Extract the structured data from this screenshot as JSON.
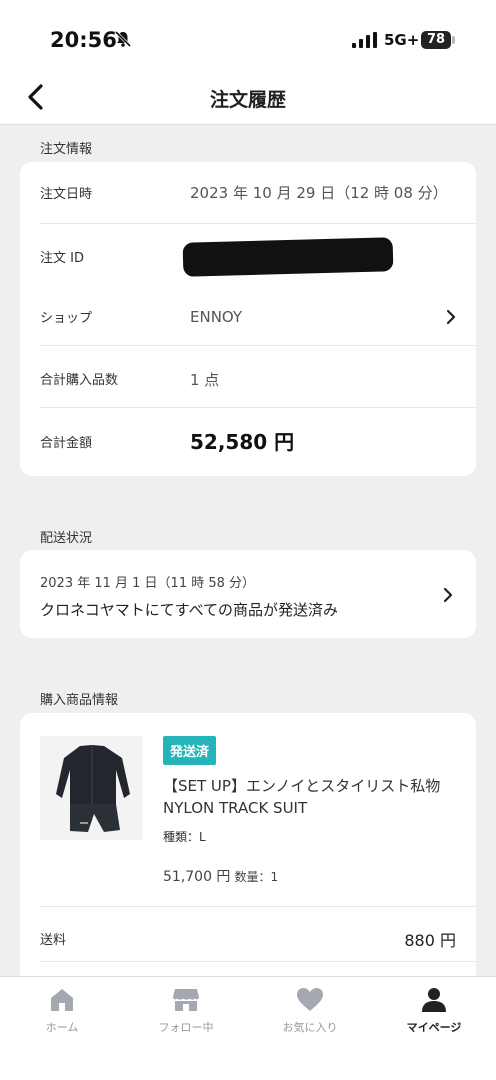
{
  "status_bar": {
    "time": "20:56",
    "network": "5G+",
    "battery": "78"
  },
  "nav": {
    "title": "注文履歴"
  },
  "order_info": {
    "section_label": "注文情報",
    "rows": {
      "date": {
        "label": "注文日時",
        "value": "2023 年 10 月 29 日（12 時 08 分）"
      },
      "id": {
        "label": "注文 ID"
      },
      "shop": {
        "label": "ショップ",
        "value": "ENNOY"
      },
      "count": {
        "label": "合計購入品数",
        "value": "1 点"
      },
      "total": {
        "label": "合計金額",
        "value": "52,580 円"
      }
    }
  },
  "shipping": {
    "section_label": "配送状況",
    "date": "2023 年 11 月 1 日（11 時 58 分）",
    "message": "クロネコヤマトにてすべての商品が発送済み"
  },
  "products": {
    "section_label": "購入商品情報",
    "item": {
      "badge": "発送済",
      "name": "【SET UP】エンノイとスタイリスト私物 NYLON TRACK SUIT",
      "variant": "種類：L",
      "price": "51,700 円",
      "quantity": "数量：1"
    },
    "fee": {
      "label": "送料",
      "value": "880 円"
    }
  },
  "tabs": [
    {
      "label": "ホーム",
      "icon": "home-icon"
    },
    {
      "label": "フォロー中",
      "icon": "store-icon"
    },
    {
      "label": "お気に入り",
      "icon": "heart-icon"
    },
    {
      "label": "マイページ",
      "icon": "person-icon"
    }
  ],
  "colors": {
    "accent": "#25b4b7",
    "background": "#efefef",
    "active_tab": "#222222",
    "inactive_tab": "#999999"
  }
}
